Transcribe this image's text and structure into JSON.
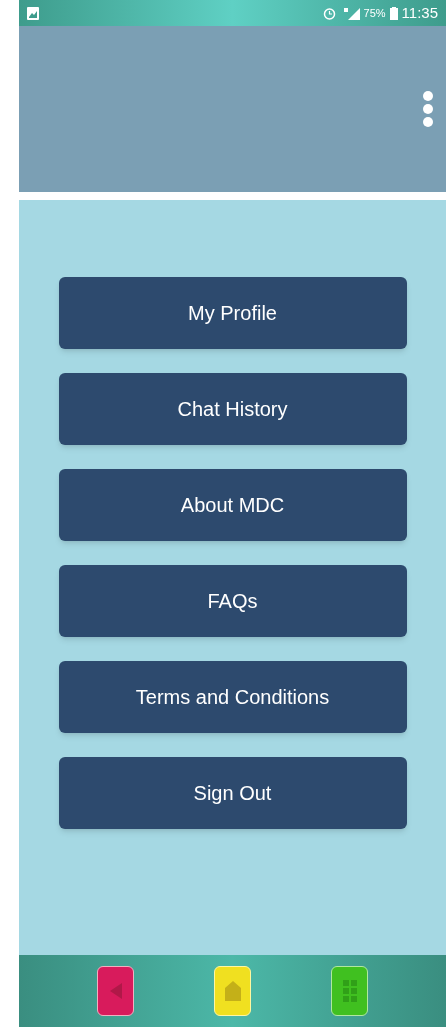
{
  "status_bar": {
    "battery": "75%",
    "time": "11:35"
  },
  "menu_items": [
    "My Profile",
    "Chat History",
    "About MDC",
    "FAQs",
    "Terms and Conditions",
    "Sign Out"
  ]
}
